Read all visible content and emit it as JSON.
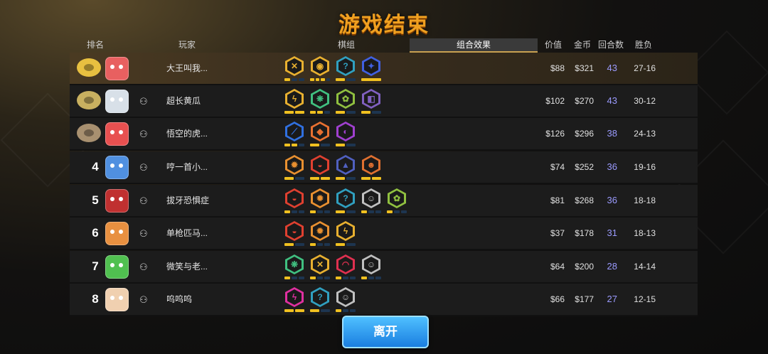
{
  "title": "游戏结束",
  "headers": {
    "rank": "排名",
    "player": "玩家",
    "tab_pieces": "棋组",
    "tab_synergy": "组合效果",
    "value": "价值",
    "gold": "金币",
    "rounds": "回合数",
    "winloss": "胜负"
  },
  "colors": {
    "gold_pip": "#f0c020",
    "empty_pip": "#1d3550",
    "title": "#f0a020",
    "button": "#1a7ee0"
  },
  "rows": [
    {
      "rank": "",
      "name": "大王叫我...",
      "value": "$88",
      "gold": "$321",
      "rounds": "43",
      "wl": "27-16"
    },
    {
      "rank": "",
      "name": "超长黄瓜",
      "value": "$102",
      "gold": "$270",
      "rounds": "43",
      "wl": "30-12"
    },
    {
      "rank": "",
      "name": "悟空的虎...",
      "value": "$126",
      "gold": "$296",
      "rounds": "38",
      "wl": "24-13"
    },
    {
      "rank": "4",
      "name": "哼一首小...",
      "value": "$74",
      "gold": "$252",
      "rounds": "36",
      "wl": "19-16"
    },
    {
      "rank": "5",
      "name": "拔牙恐惧症",
      "value": "$81",
      "gold": "$268",
      "rounds": "36",
      "wl": "18-18"
    },
    {
      "rank": "6",
      "name": "单枪匹马...",
      "value": "$37",
      "gold": "$178",
      "rounds": "31",
      "wl": "18-13"
    },
    {
      "rank": "7",
      "name": "微笑与老...",
      "value": "$64",
      "gold": "$200",
      "rounds": "28",
      "wl": "14-14"
    },
    {
      "rank": "8",
      "name": "呜呜呜",
      "value": "$66",
      "gold": "$177",
      "rounds": "27",
      "wl": "12-15"
    }
  ],
  "leave_label": "离开",
  "add_friend_icon": "add-friend-icon"
}
